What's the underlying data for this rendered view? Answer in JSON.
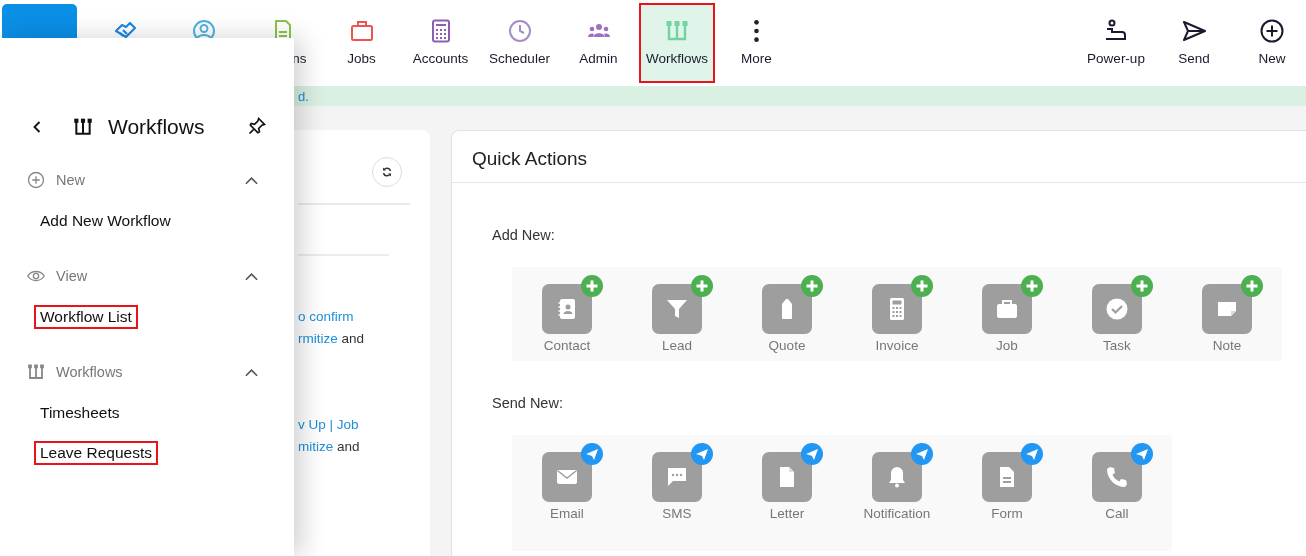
{
  "nav": {
    "items": [
      {
        "kind": "handshake",
        "selected": false
      },
      {
        "kind": "contacts",
        "selected": false
      },
      {
        "kind": "document",
        "label": "ns",
        "partly_hidden": true,
        "selected": false
      },
      {
        "kind": "jobs",
        "label": "Jobs",
        "selected": false
      },
      {
        "kind": "accounts",
        "label": "Accounts",
        "selected": false
      },
      {
        "kind": "scheduler",
        "label": "Scheduler",
        "selected": false
      },
      {
        "kind": "admin",
        "label": "Admin",
        "selected": false
      },
      {
        "kind": "workflows",
        "label": "Workflows",
        "selected": true
      },
      {
        "kind": "more",
        "label": "More",
        "selected": false
      }
    ],
    "actions": [
      {
        "kind": "powerup",
        "label": "Power-up"
      },
      {
        "kind": "send",
        "label": "Send"
      },
      {
        "kind": "new",
        "label": "New"
      }
    ]
  },
  "banner": {
    "text": "d."
  },
  "left_card": {
    "paragraphs": [
      [
        [
          {
            "text": "o confirm",
            "link": true
          }
        ],
        [
          {
            "text": "rmitize",
            "link": true
          },
          {
            "text": " and",
            "link": false
          }
        ]
      ],
      [
        [
          {
            "text": "v Up | Job",
            "link": true
          }
        ],
        [
          {
            "text": "mitize",
            "link": true
          },
          {
            "text": " and",
            "link": false
          }
        ]
      ]
    ]
  },
  "quick_actions": {
    "title": "Quick Actions",
    "groups": [
      {
        "label": "Add New:",
        "kind": "add",
        "items": [
          {
            "kind": "contact",
            "label": "Contact"
          },
          {
            "kind": "lead",
            "label": "Lead"
          },
          {
            "kind": "quote",
            "label": "Quote"
          },
          {
            "kind": "invoice",
            "label": "Invoice"
          },
          {
            "kind": "job",
            "label": "Job"
          },
          {
            "kind": "task",
            "label": "Task"
          },
          {
            "kind": "note",
            "label": "Note"
          }
        ]
      },
      {
        "label": "Send New:",
        "kind": "send",
        "items": [
          {
            "kind": "email",
            "label": "Email"
          },
          {
            "kind": "sms",
            "label": "SMS"
          },
          {
            "kind": "letter",
            "label": "Letter"
          },
          {
            "kind": "notification",
            "label": "Notification"
          },
          {
            "kind": "form",
            "label": "Form"
          },
          {
            "kind": "call",
            "label": "Call"
          }
        ]
      }
    ]
  },
  "drawer": {
    "title": "Workflows",
    "sections": [
      {
        "kind": "new",
        "label": "New",
        "expanded": true,
        "items": [
          {
            "label": "Add New Workflow",
            "highlighted": false
          }
        ]
      },
      {
        "kind": "view",
        "label": "View",
        "expanded": true,
        "items": [
          {
            "label": "Workflow List",
            "highlighted": true
          }
        ]
      },
      {
        "kind": "workflows",
        "label": "Workflows",
        "expanded": true,
        "items": [
          {
            "label": "Timesheets",
            "highlighted": false
          },
          {
            "label": "Leave Requests",
            "highlighted": true
          }
        ]
      }
    ]
  }
}
